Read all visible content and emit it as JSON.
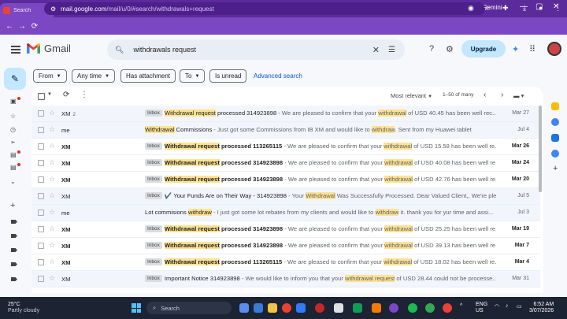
{
  "browser": {
    "tabs": [
      {
        "label": "Search",
        "active": true,
        "favicon_color": "#ea4335"
      },
      {
        "label": "iCloud",
        "active": false,
        "favicon_color": "#f9ab00"
      },
      {
        "label": "TheBe",
        "active": false,
        "favicon_color": "#111111"
      },
      {
        "label": "xero/s",
        "active": false,
        "favicon_color": "#24292f"
      },
      {
        "label": "ok in l",
        "active": false,
        "favicon_color": "#6b7280"
      },
      {
        "label": "web m",
        "active": false,
        "favicon_color": "#1a73e8"
      },
      {
        "label": "web in",
        "active": false,
        "favicon_color": "#1a73e8"
      },
      {
        "label": "(3) Fa",
        "active": false,
        "favicon_color": "#1877f2"
      },
      {
        "label": "Otto F",
        "active": false,
        "favicon_color": "#e4405f"
      }
    ],
    "new_tab": "+",
    "ask_gemini": "Ask Gemini",
    "url_host": "mail.google.com",
    "url_path": "/mail/u/0/#search/withdrawals+request"
  },
  "gmail": {
    "logo_text": "Gmail",
    "search_query": "withdrawals request",
    "upgrade_label": "Upgrade"
  },
  "filters": {
    "from": "From",
    "any_time": "Any time",
    "has_attachment": "Has attachment",
    "to": "To",
    "is_unread": "Is unread",
    "advanced_search": "Advanced search"
  },
  "toolbar": {
    "sort": "Most relevant",
    "page_info": "1–50 of many"
  },
  "emails": [
    {
      "sender": "XM",
      "count": "2",
      "unread": false,
      "inbox": "Inbox",
      "subject": [
        {
          "t": "Withdrawal request",
          "h": true
        },
        {
          "t": " processed 314923898",
          "h": false
        }
      ],
      "snippet": [
        {
          "t": "We are pleased to confirm that your ",
          "h": false
        },
        {
          "t": "withdrawal",
          "h": true
        },
        {
          "t": " of USD 40.45 has been well rec...",
          "h": false
        }
      ],
      "date": "Mar 27"
    },
    {
      "sender": "me",
      "count": "",
      "unread": false,
      "inbox": "",
      "subject": [
        {
          "t": "Withdrawal",
          "h": true
        },
        {
          "t": " Commissions",
          "h": false
        }
      ],
      "snippet": [
        {
          "t": "Just got some Commissions from IB XM and would like to ",
          "h": false
        },
        {
          "t": "withdraw",
          "h": true
        },
        {
          "t": ". Sent from my Huawei tablet",
          "h": false
        }
      ],
      "date": "Jul 4"
    },
    {
      "sender": "XM",
      "count": "",
      "unread": true,
      "inbox": "Inbox",
      "subject": [
        {
          "t": "Withdrawal request",
          "h": true
        },
        {
          "t": " processed 113265115",
          "h": false
        }
      ],
      "snippet": [
        {
          "t": "We are pleased to confirm that your ",
          "h": false
        },
        {
          "t": "withdrawal",
          "h": true
        },
        {
          "t": " of USD 15.58 has been well re...",
          "h": false
        }
      ],
      "date": "Mar 26"
    },
    {
      "sender": "XM",
      "count": "",
      "unread": true,
      "inbox": "Inbox",
      "subject": [
        {
          "t": "Withdrawal request",
          "h": true
        },
        {
          "t": " processed 314923898",
          "h": false
        }
      ],
      "snippet": [
        {
          "t": "We are pleased to confirm that your ",
          "h": false
        },
        {
          "t": "withdrawal",
          "h": true
        },
        {
          "t": " of USD 40.08 has been well re...",
          "h": false
        }
      ],
      "date": "Mar 24"
    },
    {
      "sender": "XM",
      "count": "",
      "unread": true,
      "inbox": "Inbox",
      "subject": [
        {
          "t": "Withdrawal request",
          "h": true
        },
        {
          "t": " processed 314923898",
          "h": false
        }
      ],
      "snippet": [
        {
          "t": "We are pleased to confirm that your ",
          "h": false
        },
        {
          "t": "withdrawal",
          "h": true
        },
        {
          "t": " of USD 42.76 has been well re...",
          "h": false
        }
      ],
      "date": "Mar 20"
    },
    {
      "sender": "XM",
      "count": "",
      "unread": false,
      "inbox": "Inbox",
      "subject": [
        {
          "t": "✔️ Your Funds Are on Their Way - 314923898",
          "h": false
        }
      ],
      "snippet": [
        {
          "t": "Your ",
          "h": false
        },
        {
          "t": "Withdrawal",
          "h": true
        },
        {
          "t": " Was Successfully Processed. Dear Valued Client,, We're ple...",
          "h": false
        }
      ],
      "date": "Jul 5"
    },
    {
      "sender": "me",
      "count": "",
      "unread": false,
      "inbox": "",
      "subject": [
        {
          "t": "Lot commisions ",
          "h": false
        },
        {
          "t": "withdraw",
          "h": true
        }
      ],
      "snippet": [
        {
          "t": "I just got some lot rebates from my clients and would like to ",
          "h": false
        },
        {
          "t": "withdraw",
          "h": true
        },
        {
          "t": " it. thank you for yur time and assi...",
          "h": false
        }
      ],
      "date": "Jul 3"
    },
    {
      "sender": "XM",
      "count": "",
      "unread": true,
      "inbox": "Inbox",
      "subject": [
        {
          "t": "Withdrawal request",
          "h": true
        },
        {
          "t": " processed 314923898",
          "h": false
        }
      ],
      "snippet": [
        {
          "t": "We are pleased to confirm that your ",
          "h": false
        },
        {
          "t": "withdrawal",
          "h": true
        },
        {
          "t": " of USD 25.25 has been well re...",
          "h": false
        }
      ],
      "date": "Mar 19"
    },
    {
      "sender": "XM",
      "count": "",
      "unread": true,
      "inbox": "Inbox",
      "subject": [
        {
          "t": "Withdrawal request",
          "h": true
        },
        {
          "t": " processed 314923898",
          "h": false
        }
      ],
      "snippet": [
        {
          "t": "We are pleased to confirm that your ",
          "h": false
        },
        {
          "t": "withdrawal",
          "h": true
        },
        {
          "t": " of USD 39.13 has been well re...",
          "h": false
        }
      ],
      "date": "Mar 7"
    },
    {
      "sender": "XM",
      "count": "",
      "unread": true,
      "inbox": "Inbox",
      "subject": [
        {
          "t": "Withdrawal request",
          "h": true
        },
        {
          "t": " processed 113265115",
          "h": false
        }
      ],
      "snippet": [
        {
          "t": "We are pleased to confirm that your ",
          "h": false
        },
        {
          "t": "withdrawal",
          "h": true
        },
        {
          "t": " of USD 18.02 has been well re...",
          "h": false
        }
      ],
      "date": "Mar 4"
    },
    {
      "sender": "XM",
      "count": "",
      "unread": false,
      "inbox": "Inbox",
      "subject": [
        {
          "t": "Important Notice 314923898",
          "h": false
        }
      ],
      "snippet": [
        {
          "t": "We would like to inform you that your ",
          "h": false
        },
        {
          "t": "withdrawal request",
          "h": true
        },
        {
          "t": " of USD 28.44 could not be processe...",
          "h": false
        }
      ],
      "date": "Mar 31"
    }
  ],
  "taskbar": {
    "weather_temp": "25°C",
    "weather_desc": "Partly cloudy",
    "search_label": "Search",
    "lang": "ENG",
    "region": "US",
    "time": "6:52 AM",
    "date": "3/07/2026"
  }
}
